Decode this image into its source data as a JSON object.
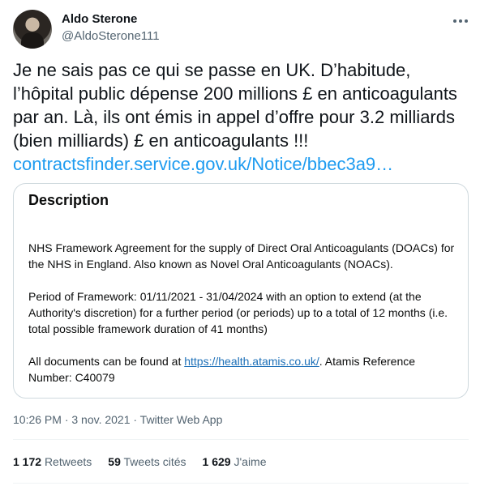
{
  "author": {
    "name": "Aldo Sterone",
    "handle": "@AldoSterone111"
  },
  "tweet": {
    "text": "Je ne sais pas ce qui se passe en UK. D’habitude, l’hôpital public dépense 200 millions £ en anticoagulants par an. Là, ils ont émis in appel d’offre pour 3.2 milliards (bien milliards) £ en anticoagulants !!!",
    "link_text": "contractsfinder.service.gov.uk/Notice/bbec3a9…"
  },
  "card": {
    "title": "Description",
    "para1": "NHS Framework Agreement for the supply of Direct Oral Anticoagulants (DOACs) for the NHS in England. Also known as Novel Oral Anticoagulants (NOACs).",
    "para2": "Period of Framework: 01/11/2021 - 31/04/2024 with an option to extend (at the Authority's discretion) for a further period (or periods) up to a total of 12 months (i.e. total possible framework duration of 41 months)",
    "para3_before": "All documents can be found at ",
    "para3_link": "https://health.atamis.co.uk/",
    "para3_after": ". Atamis Reference Number: C40079"
  },
  "meta": {
    "time": "10:26 PM · 3 nov. 2021 · Twitter Web App"
  },
  "stats": {
    "retweets_count": "1 172",
    "retweets_label": "Retweets",
    "quotes_count": "59",
    "quotes_label": "Tweets cités",
    "likes_count": "1 629",
    "likes_label": "J'aime"
  },
  "colors": {
    "link": "#1d9bf0",
    "secondary_text": "#536471",
    "gov_link": "#1d70b8"
  }
}
